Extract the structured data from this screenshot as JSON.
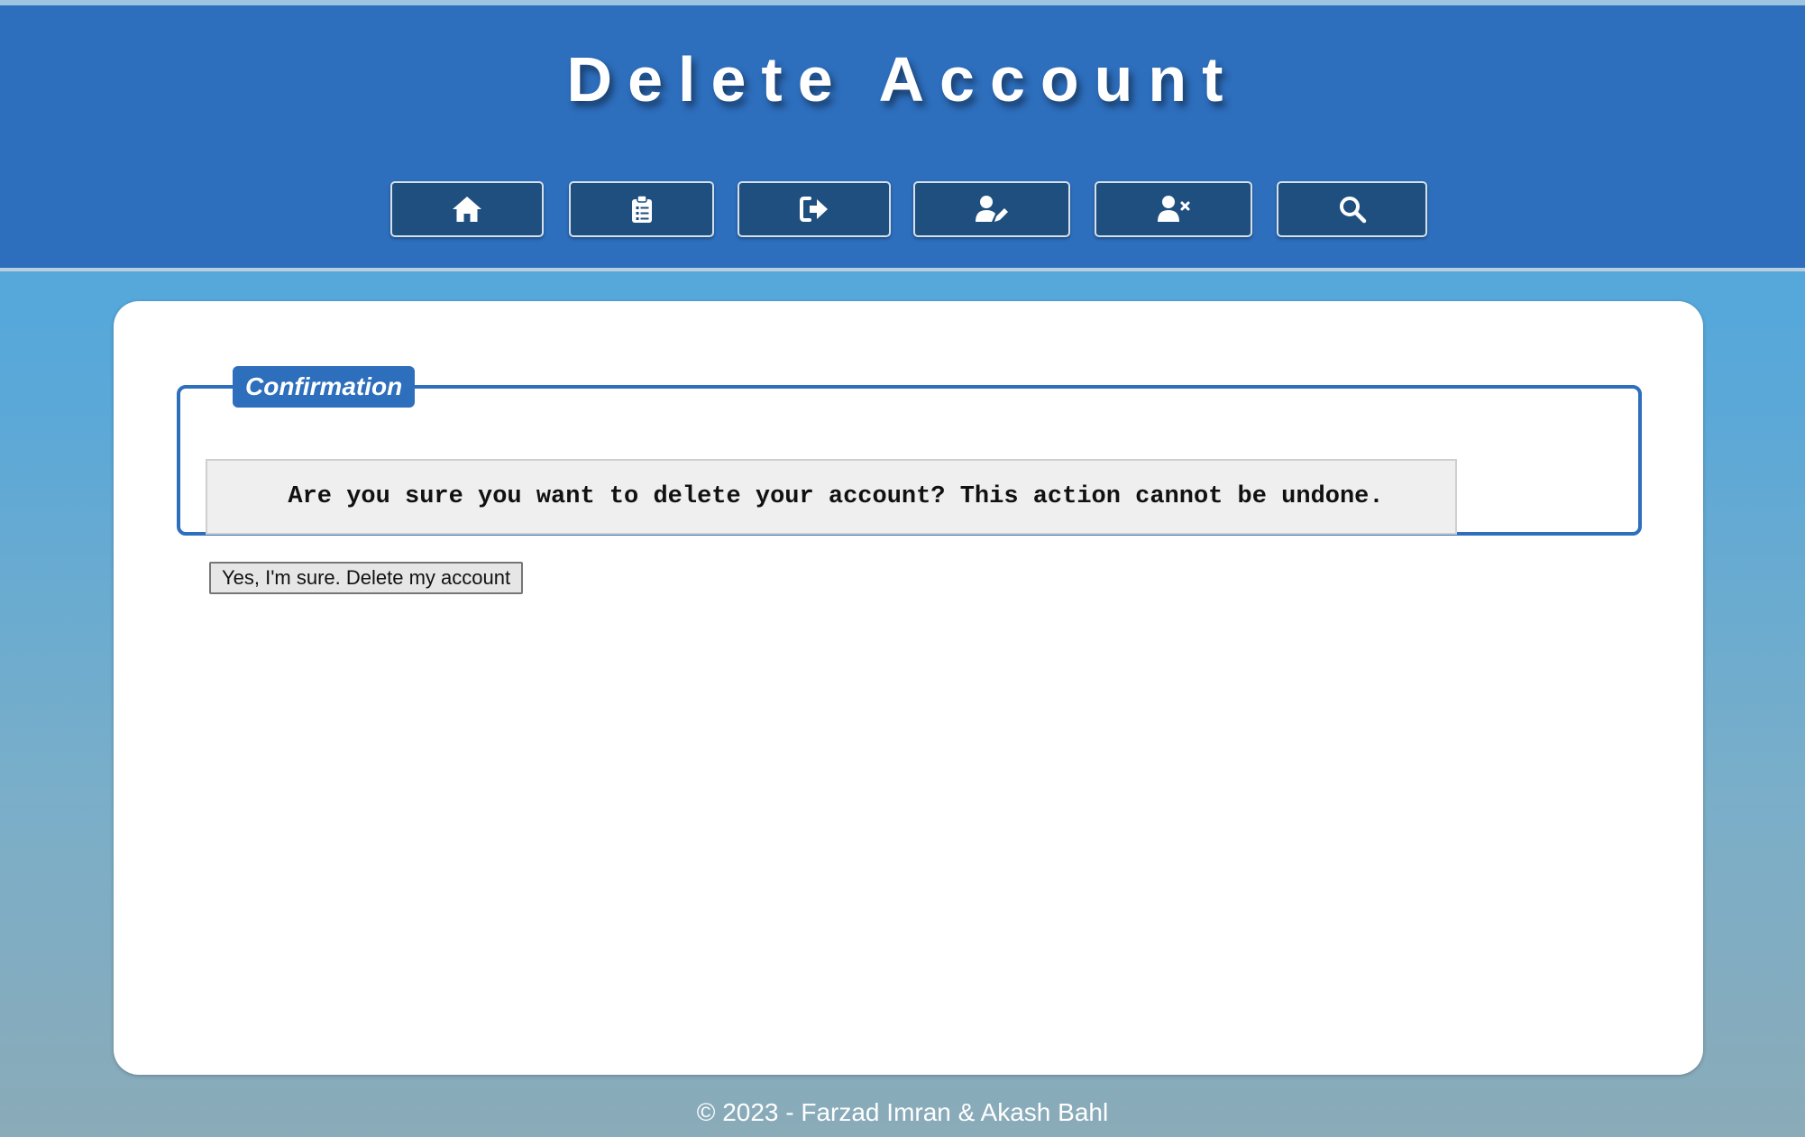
{
  "header": {
    "title": "Delete Account",
    "nav": [
      {
        "icon": "home-icon"
      },
      {
        "icon": "clipboard-list-icon"
      },
      {
        "icon": "sign-out-icon"
      },
      {
        "icon": "user-edit-icon"
      },
      {
        "icon": "user-delete-icon"
      },
      {
        "icon": "search-icon"
      }
    ]
  },
  "confirmation": {
    "legend": "Confirmation",
    "message": "Are you sure you want to delete your account? This action cannot be undone.",
    "confirm_button": "Yes, I'm sure. Delete my account"
  },
  "footer": {
    "text": "© 2023 - Farzad Imran & Akash Bahl"
  },
  "colors": {
    "header": "#2d6ebd",
    "nav_button": "#1f4f7f",
    "accent": "#2d6ebd"
  }
}
